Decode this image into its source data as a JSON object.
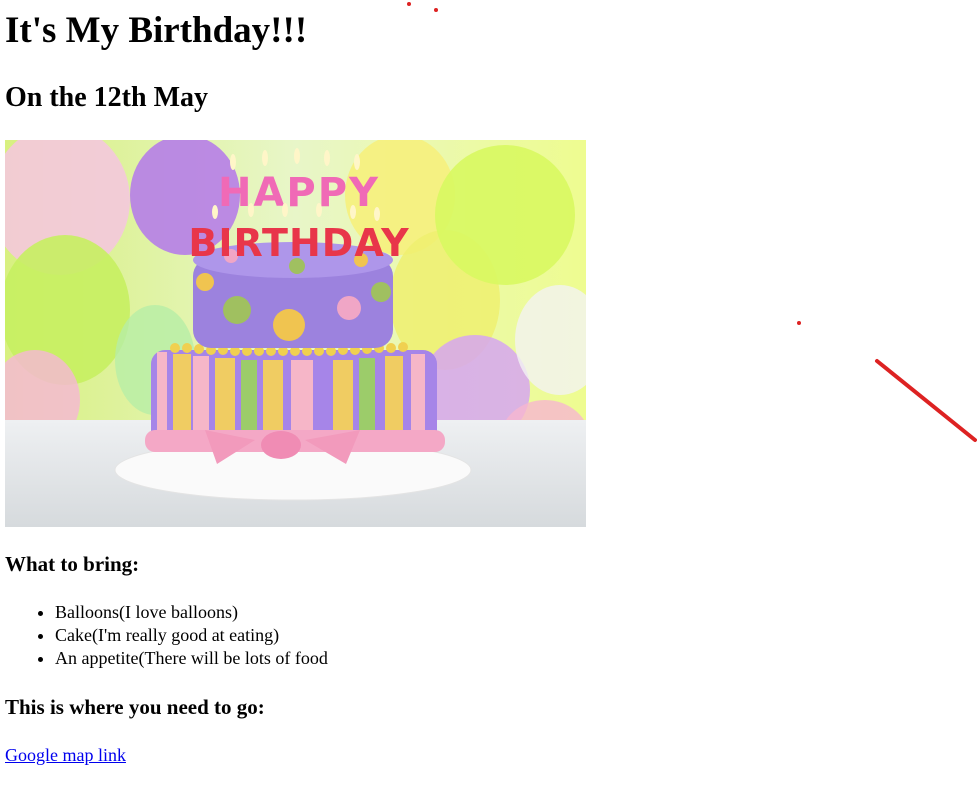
{
  "heading": {
    "title": "It's My Birthday!!!",
    "date": "On the 12th May"
  },
  "image": {
    "description": "cake-photo",
    "candle_text": [
      "HAPPY",
      "BIRTHDAY"
    ]
  },
  "bring": {
    "heading": "What to bring:",
    "items": [
      "Balloons(I love balloons)",
      "Cake(I'm really good at eating)",
      "An appetite(There will be lots of food"
    ]
  },
  "directions": {
    "heading": "This is where you need to go:",
    "link_text": "Google map link"
  },
  "colors": {
    "link": "#0000ee",
    "annotation": "#dd2222"
  }
}
